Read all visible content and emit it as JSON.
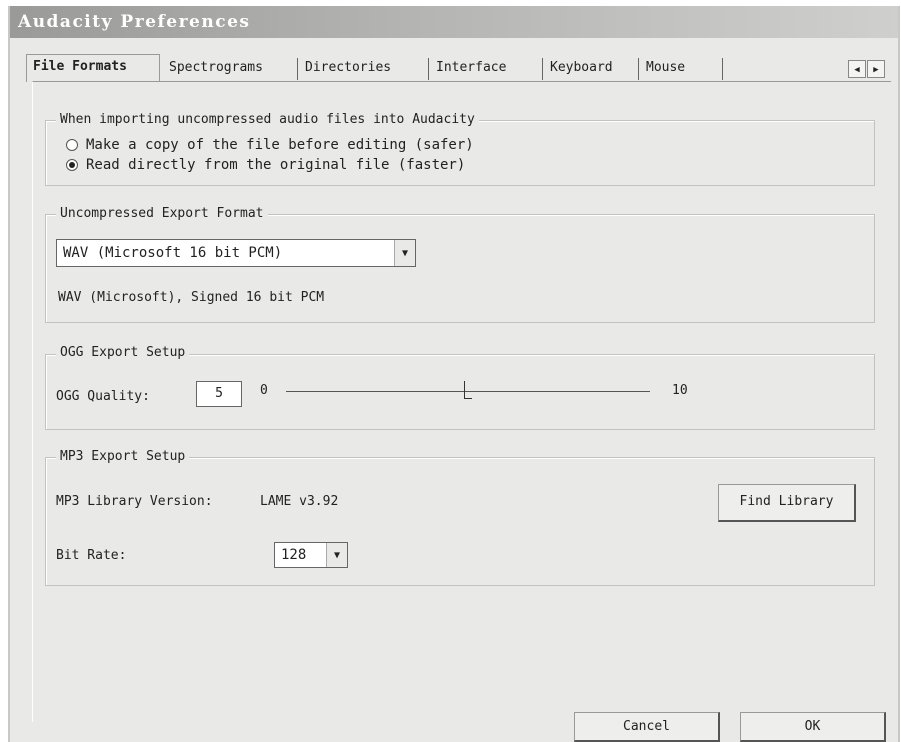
{
  "window": {
    "title": "Audacity Preferences"
  },
  "tabs": [
    {
      "label": "File Formats",
      "active": true
    },
    {
      "label": "Spectrograms"
    },
    {
      "label": "Directories"
    },
    {
      "label": "Interface"
    },
    {
      "label": "Keyboard"
    },
    {
      "label": "Mouse"
    }
  ],
  "tab_scroll": {
    "left": "◀",
    "right": "▶"
  },
  "import_group": {
    "legend": "When importing uncompressed audio files into Audacity",
    "options": [
      {
        "label": "Make a copy of the file before editing (safer)",
        "checked": false
      },
      {
        "label": "Read directly from the original file (faster)",
        "checked": true
      }
    ]
  },
  "export_group": {
    "legend": "Uncompressed Export Format",
    "selected": "WAV (Microsoft 16 bit PCM)",
    "description": "WAV (Microsoft), Signed 16 bit PCM"
  },
  "ogg_group": {
    "legend": "OGG Export Setup",
    "quality_label": "OGG Quality:",
    "quality_value": "5",
    "min_label": "0",
    "max_label": "10",
    "slider_value": 5
  },
  "mp3_group": {
    "legend": "MP3 Export Setup",
    "library_label": "MP3 Library Version:",
    "library_version": "LAME v3.92",
    "find_library_label": "Find Library",
    "bitrate_label": "Bit Rate:",
    "bitrate_value": "128"
  },
  "footer": {
    "cancel_label": "Cancel",
    "ok_label": "OK"
  },
  "icons": {
    "dropdown": "chevron-down-icon"
  }
}
